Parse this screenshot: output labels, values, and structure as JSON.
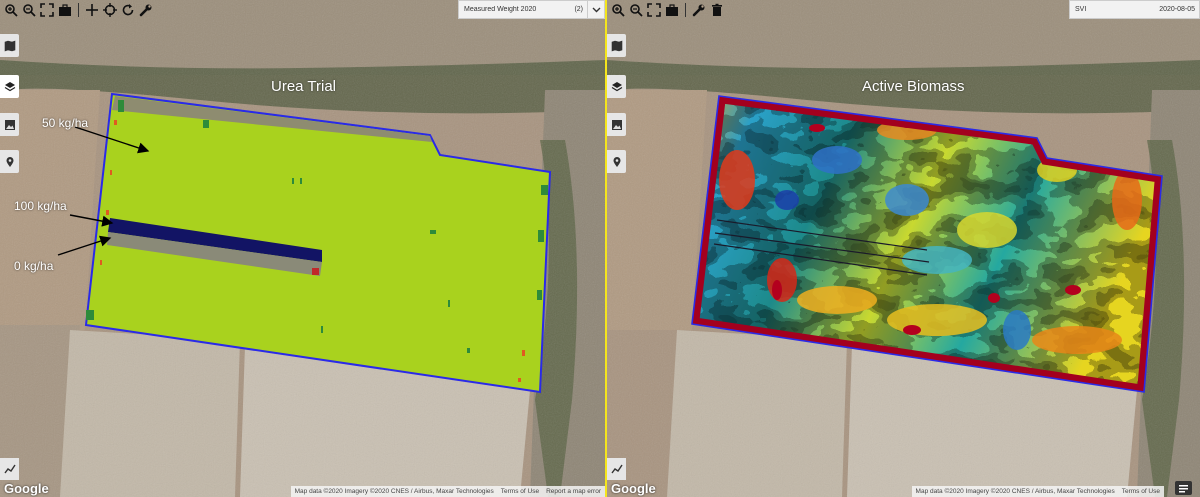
{
  "left_panel": {
    "toolbar": {
      "icons": [
        "zoom-in-icon",
        "zoom-out-icon",
        "fullscreen-icon",
        "briefcase-icon",
        "crosshair-plus-icon",
        "target-icon",
        "refresh-icon",
        "wrench-icon"
      ]
    },
    "layer_select": {
      "label": "Measured Weight 2020",
      "count": "(2)"
    },
    "sidebar": [
      "map-icon",
      "layers-icon",
      "image-icon",
      "pin-icon"
    ],
    "title": "Urea Trial",
    "rates": {
      "r50": "50 kg/ha",
      "r100": "100 kg/ha",
      "r0": "0 kg/ha"
    },
    "colors": {
      "field": "#a9d21e",
      "strip_100": "#121464",
      "strip_0": "#8a8a78",
      "boundary": "#2a2ae8"
    }
  },
  "right_panel": {
    "toolbar": {
      "icons": [
        "zoom-in-icon",
        "zoom-out-icon",
        "fullscreen-icon",
        "briefcase-icon",
        "wrench-icon",
        "trash-icon"
      ]
    },
    "layer_select": {
      "label": "SVI",
      "date": "2020-08-05"
    },
    "sidebar": [
      "map-icon",
      "layers-icon",
      "image-icon",
      "pin-icon"
    ],
    "title": "Active Biomass",
    "colors": {
      "edge": "#a3001e",
      "boundary": "#2a2ae8"
    }
  },
  "footer": {
    "google": "Google",
    "map_data": "Map data ©2020 Imagery ©2020 CNES / Airbus, Maxar Technologies",
    "terms": "Terms of Use",
    "report": "Report a map error"
  },
  "colors": {
    "divider": "#f4e51d"
  }
}
